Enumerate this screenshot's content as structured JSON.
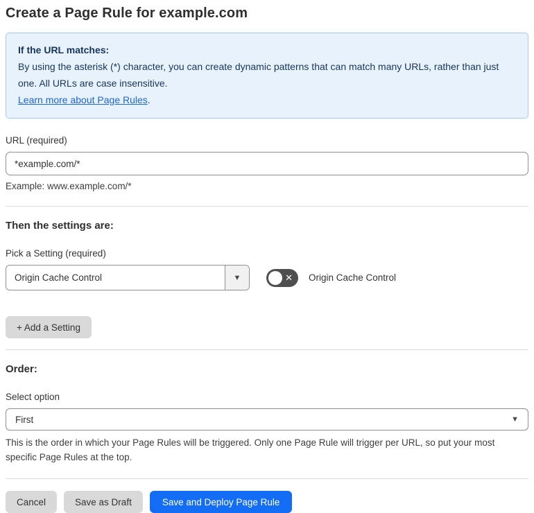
{
  "page": {
    "title": "Create a Page Rule for example.com"
  },
  "info_box": {
    "heading": "If the URL matches:",
    "body": "By using the asterisk (*) character, you can create dynamic patterns that can match many URLs, rather than just one. All URLs are case insensitive.",
    "link_label": "Learn more about Page Rules",
    "link_suffix": "."
  },
  "url_field": {
    "label": "URL (required)",
    "value": "*example.com/*",
    "example": "Example: www.example.com/*"
  },
  "settings_section": {
    "heading": "Then the settings are:",
    "picker_label": "Pick a Setting (required)",
    "picker_value": "Origin Cache Control",
    "picker_arrow": "▼",
    "toggle": {
      "state": "off",
      "x_glyph": "✕",
      "label": "Origin Cache Control"
    },
    "add_button_label": "+ Add a Setting"
  },
  "order_section": {
    "heading": "Order:",
    "select_label": "Select option",
    "select_value": "First",
    "select_caret": "▼",
    "help_text": "This is the order in which your Page Rules will be triggered. Only one Page Rule will trigger per URL, so put your most specific Page Rules at the top."
  },
  "footer": {
    "cancel_label": "Cancel",
    "save_draft_label": "Save as Draft",
    "save_deploy_label": "Save and Deploy Page Rule"
  },
  "colors": {
    "accent_blue": "#146ef5",
    "info_bg": "#e8f2fc",
    "info_border": "#a5c9ef",
    "info_text": "#16355c",
    "link_blue": "#1a66d9",
    "toggle_off_bg": "#4f4f4f",
    "button_gray": "#d9d9d9"
  }
}
